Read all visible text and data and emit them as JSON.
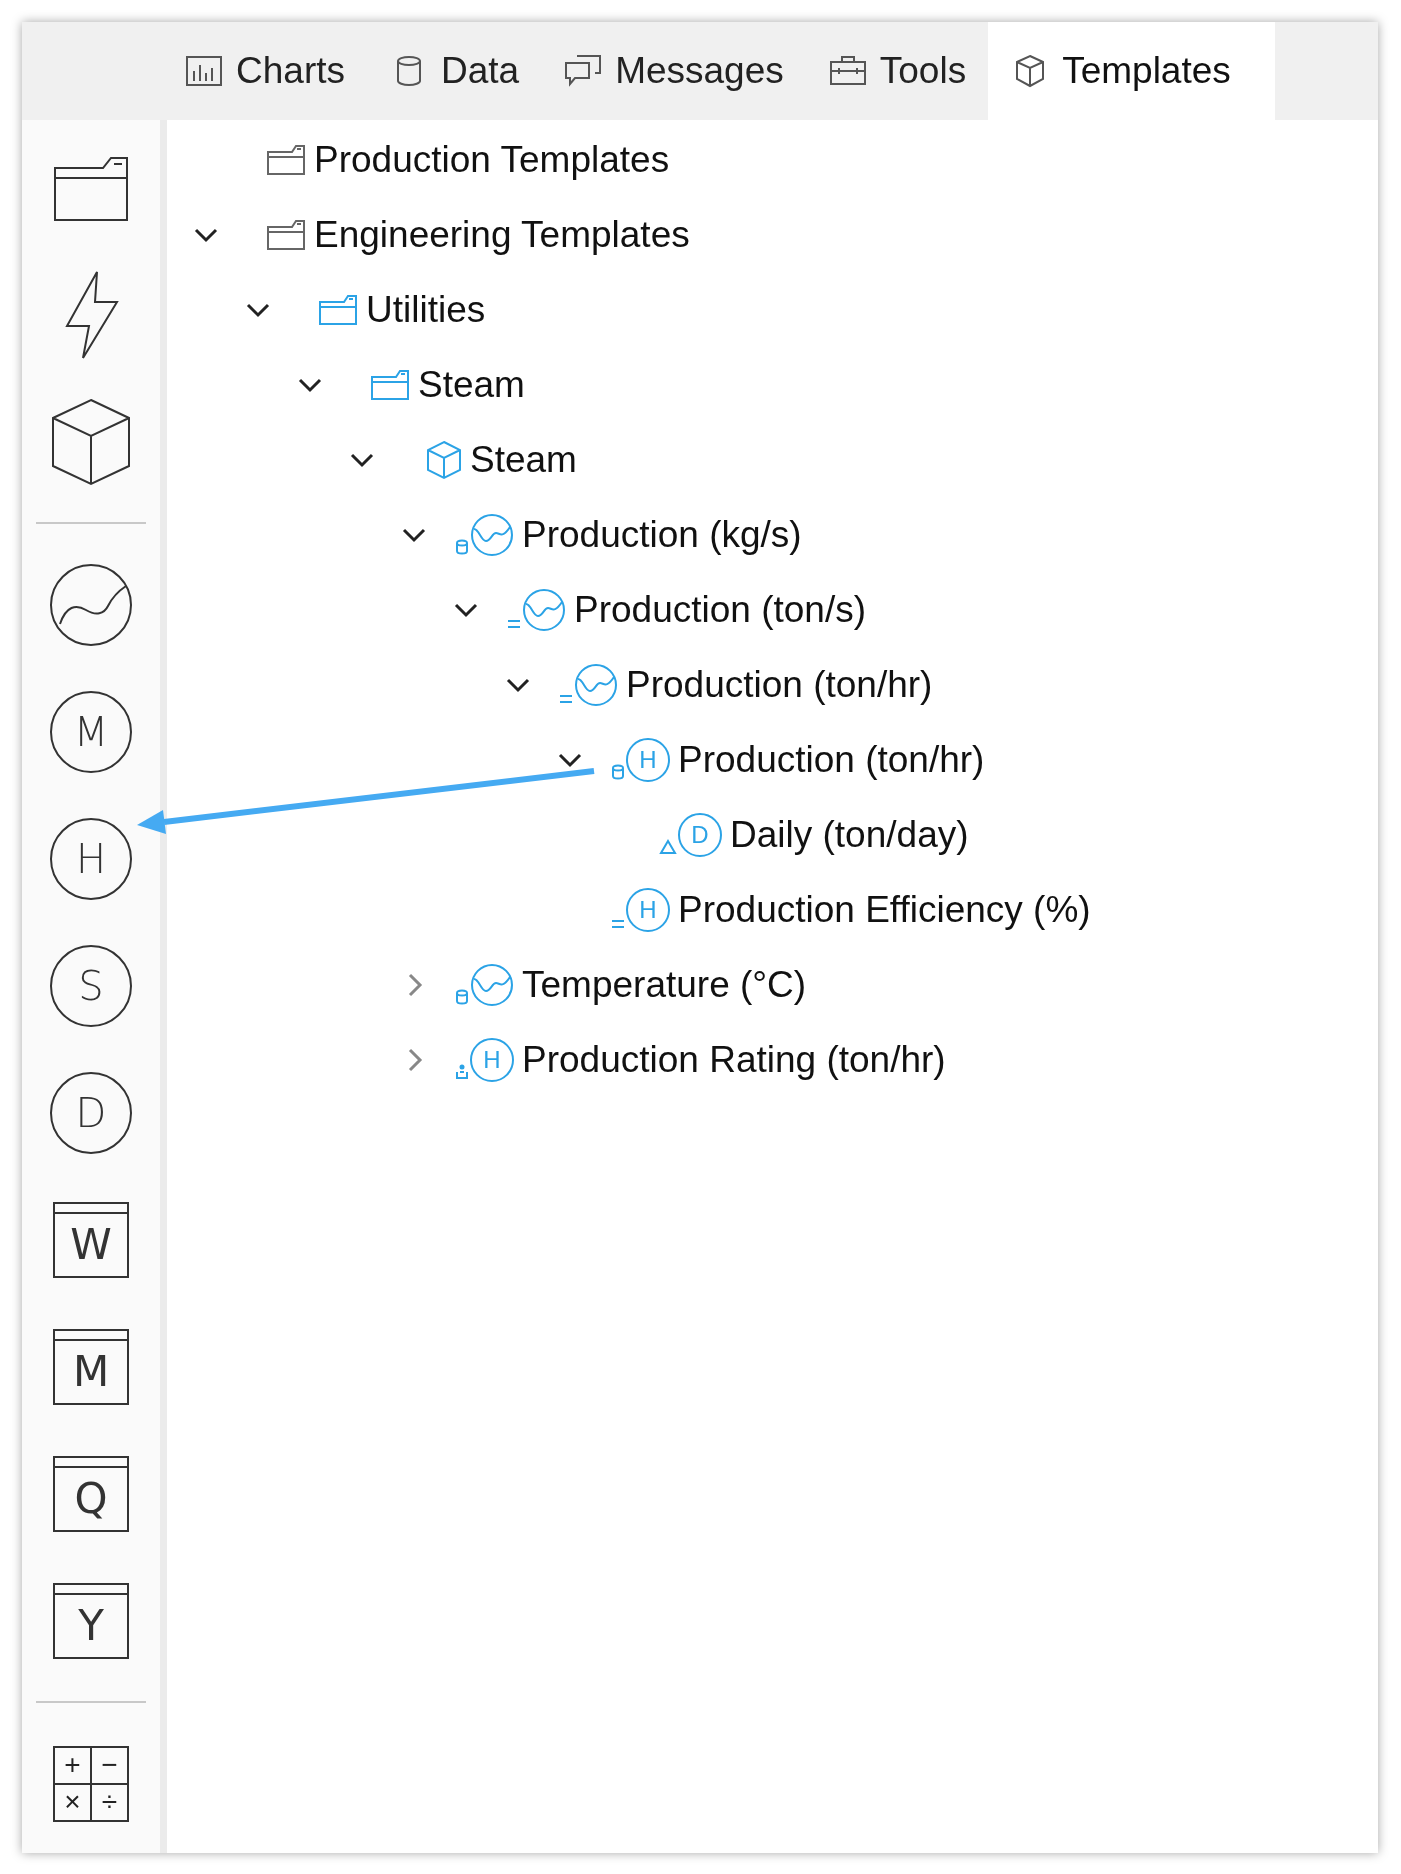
{
  "tabs": [
    {
      "label": "Charts",
      "kind": "chart",
      "selected": false
    },
    {
      "label": "Data",
      "kind": "database",
      "selected": false
    },
    {
      "label": "Messages",
      "kind": "chat",
      "selected": false
    },
    {
      "label": "Tools",
      "kind": "toolbox",
      "selected": false
    },
    {
      "label": "Templates",
      "kind": "cube",
      "selected": true
    }
  ],
  "toolbar": [
    {
      "kind": "folder"
    },
    {
      "kind": "bolt"
    },
    {
      "kind": "cube"
    },
    {
      "kind": "divider"
    },
    {
      "kind": "trend"
    },
    {
      "kind": "circle",
      "symbol": "M"
    },
    {
      "kind": "circle",
      "symbol": "H"
    },
    {
      "kind": "circle",
      "symbol": "S"
    },
    {
      "kind": "circle",
      "symbol": "D"
    },
    {
      "kind": "box",
      "symbol": "W"
    },
    {
      "kind": "box",
      "symbol": "M"
    },
    {
      "kind": "box",
      "symbol": "Q"
    },
    {
      "kind": "box",
      "symbol": "Y"
    },
    {
      "kind": "divider"
    },
    {
      "kind": "calc",
      "symbols": [
        "+",
        "−",
        "×",
        "÷"
      ]
    }
  ],
  "tree": [
    {
      "label": "Production Templates",
      "kind": "folder"
    },
    {
      "label": "Engineering Templates",
      "kind": "folder",
      "expanded": true,
      "children": [
        {
          "label": "Utilities",
          "kind": "accentfolder",
          "expanded": true,
          "children": [
            {
              "label": "Steam",
              "kind": "accentfolder",
              "expanded": true,
              "children": [
                {
                  "label": "Steam",
                  "kind": "cube",
                  "expanded": true,
                  "children": [
                    {
                      "label": "Production (kg/s)",
                      "kind": "storedtrend",
                      "expanded": true,
                      "children": [
                        {
                          "label": "Production (ton/s)",
                          "kind": "calctrend",
                          "expanded": true,
                          "children": [
                            {
                              "label": "Production (ton/hr)",
                              "kind": "calctrend",
                              "expanded": true,
                              "children": [
                                {
                                  "label": "Production (ton/hr)",
                                  "kind": "storedletter",
                                  "symbol": "H",
                                  "expanded": true,
                                  "children": [
                                    {
                                      "label": "Daily (ton/day)",
                                      "kind": "deltaletter",
                                      "symbol": "D"
                                    }
                                  ]
                                },
                                {
                                  "label": "Production Efficiency (%)",
                                  "kind": "calcletter",
                                  "symbol": "H"
                                }
                              ]
                            }
                          ]
                        }
                      ]
                    },
                    {
                      "label": "Temperature (°C)",
                      "kind": "storedtrend",
                      "expanded": false
                    },
                    {
                      "label": "Production Rating (ton/hr)",
                      "kind": "inputletter",
                      "symbol": "H",
                      "expanded": false
                    }
                  ]
                }
              ]
            }
          ]
        }
      ]
    }
  ]
}
